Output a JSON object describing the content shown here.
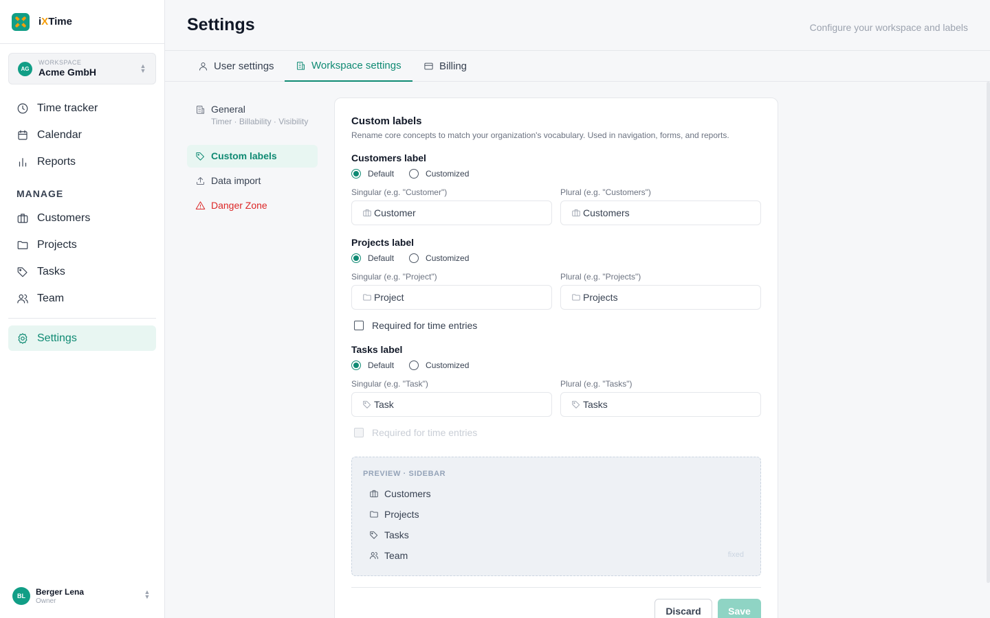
{
  "brand": {
    "prefix": "i",
    "accent": "X",
    "suffix": "Time"
  },
  "workspace": {
    "caption": "WORKSPACE",
    "initials": "AG",
    "name": "Acme GmbH"
  },
  "nav": {
    "time_tracker": "Time tracker",
    "calendar": "Calendar",
    "reports": "Reports",
    "manage_heading": "MANAGE",
    "customers": "Customers",
    "projects": "Projects",
    "tasks": "Tasks",
    "team": "Team",
    "settings": "Settings"
  },
  "user": {
    "initials": "BL",
    "name": "Berger Lena",
    "role": "Owner"
  },
  "header": {
    "title": "Settings",
    "subtitle": "Configure your workspace and labels"
  },
  "tabs": {
    "user": "User settings",
    "workspace": "Workspace settings",
    "billing": "Billing"
  },
  "subnav": {
    "general": {
      "label": "General",
      "desc": "Timer · Billability · Visibility"
    },
    "custom_labels": "Custom labels",
    "data_import": "Data import",
    "danger_zone": "Danger Zone"
  },
  "card": {
    "title": "Custom labels",
    "description": "Rename core concepts to match your organization's vocabulary. Used in navigation, forms, and reports."
  },
  "customers": {
    "title": "Customers label",
    "option_default": "Default",
    "option_customized": "Customized",
    "singular_label": "Singular (e.g. \"Customer\")",
    "singular_value": "Customer",
    "plural_label": "Plural (e.g. \"Customers\")",
    "plural_value": "Customers"
  },
  "projects": {
    "title": "Projects label",
    "option_default": "Default",
    "option_customized": "Customized",
    "singular_label": "Singular (e.g. \"Project\")",
    "singular_value": "Project",
    "plural_label": "Plural (e.g. \"Projects\")",
    "plural_value": "Projects",
    "required_label": "Required for time entries"
  },
  "tasks": {
    "title": "Tasks label",
    "option_default": "Default",
    "option_customized": "Customized",
    "singular_label": "Singular (e.g. \"Task\")",
    "singular_value": "Task",
    "plural_label": "Plural (e.g. \"Tasks\")",
    "plural_value": "Tasks",
    "required_label": "Required for time entries"
  },
  "preview": {
    "heading": "PREVIEW · SIDEBAR",
    "items": [
      "Customers",
      "Projects",
      "Tasks",
      "Team"
    ],
    "fixed_note": "fixed"
  },
  "actions": {
    "discard": "Discard",
    "save": "Save"
  },
  "colors": {
    "accent": "#0f8a73",
    "accent_bg": "#e8f6f2",
    "brand_orange": "#f59e0b",
    "danger": "#dc2626"
  }
}
